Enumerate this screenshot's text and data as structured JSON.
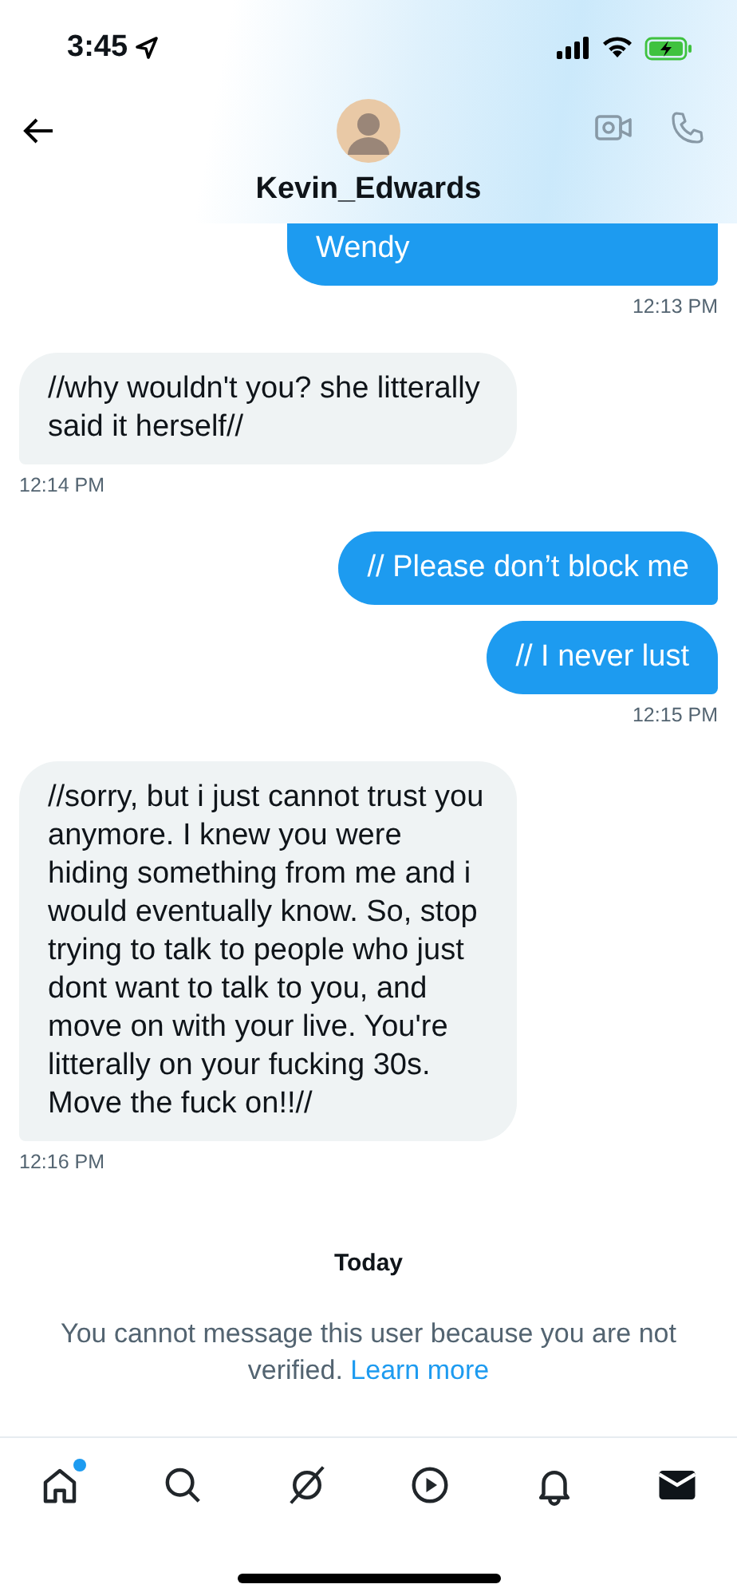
{
  "status_bar": {
    "time": "3:45"
  },
  "header": {
    "title": "Kevin_Edwards"
  },
  "messages": [
    {
      "kind": "sent",
      "text": "Wendy",
      "clipped_top": true,
      "time": "12:13 PM"
    },
    {
      "kind": "received",
      "text": "//why wouldn't you? she litterally said it herself//",
      "clipped_top": false,
      "time": "12:14 PM"
    },
    {
      "kind": "sent",
      "text": "// Please don’t block me",
      "clipped_top": false
    },
    {
      "kind": "sent",
      "text": "// I never lust",
      "clipped_top": false,
      "time": "12:15 PM"
    },
    {
      "kind": "received",
      "text": "//sorry, but i just cannot trust you anymore. I knew you were hiding something from me and i would eventually know. So, stop trying to talk to people who just dont want to talk to you, and move on with your live. You're litterally on your fucking 30s. Move the fuck on!!//",
      "clipped_top": false,
      "time": "12:16 PM"
    }
  ],
  "day_separator": "Today",
  "notice": {
    "text": "You cannot message this user because you are not verified.",
    "link": "Learn more"
  },
  "tab_bar": [
    {
      "kind": "home",
      "selected": false,
      "badge": true
    },
    {
      "kind": "search",
      "selected": false,
      "badge": false
    },
    {
      "kind": "grok",
      "selected": false,
      "badge": false
    },
    {
      "kind": "video",
      "selected": false,
      "badge": false
    },
    {
      "kind": "notifications",
      "selected": false,
      "badge": false
    },
    {
      "kind": "messages",
      "selected": true,
      "badge": false
    }
  ]
}
